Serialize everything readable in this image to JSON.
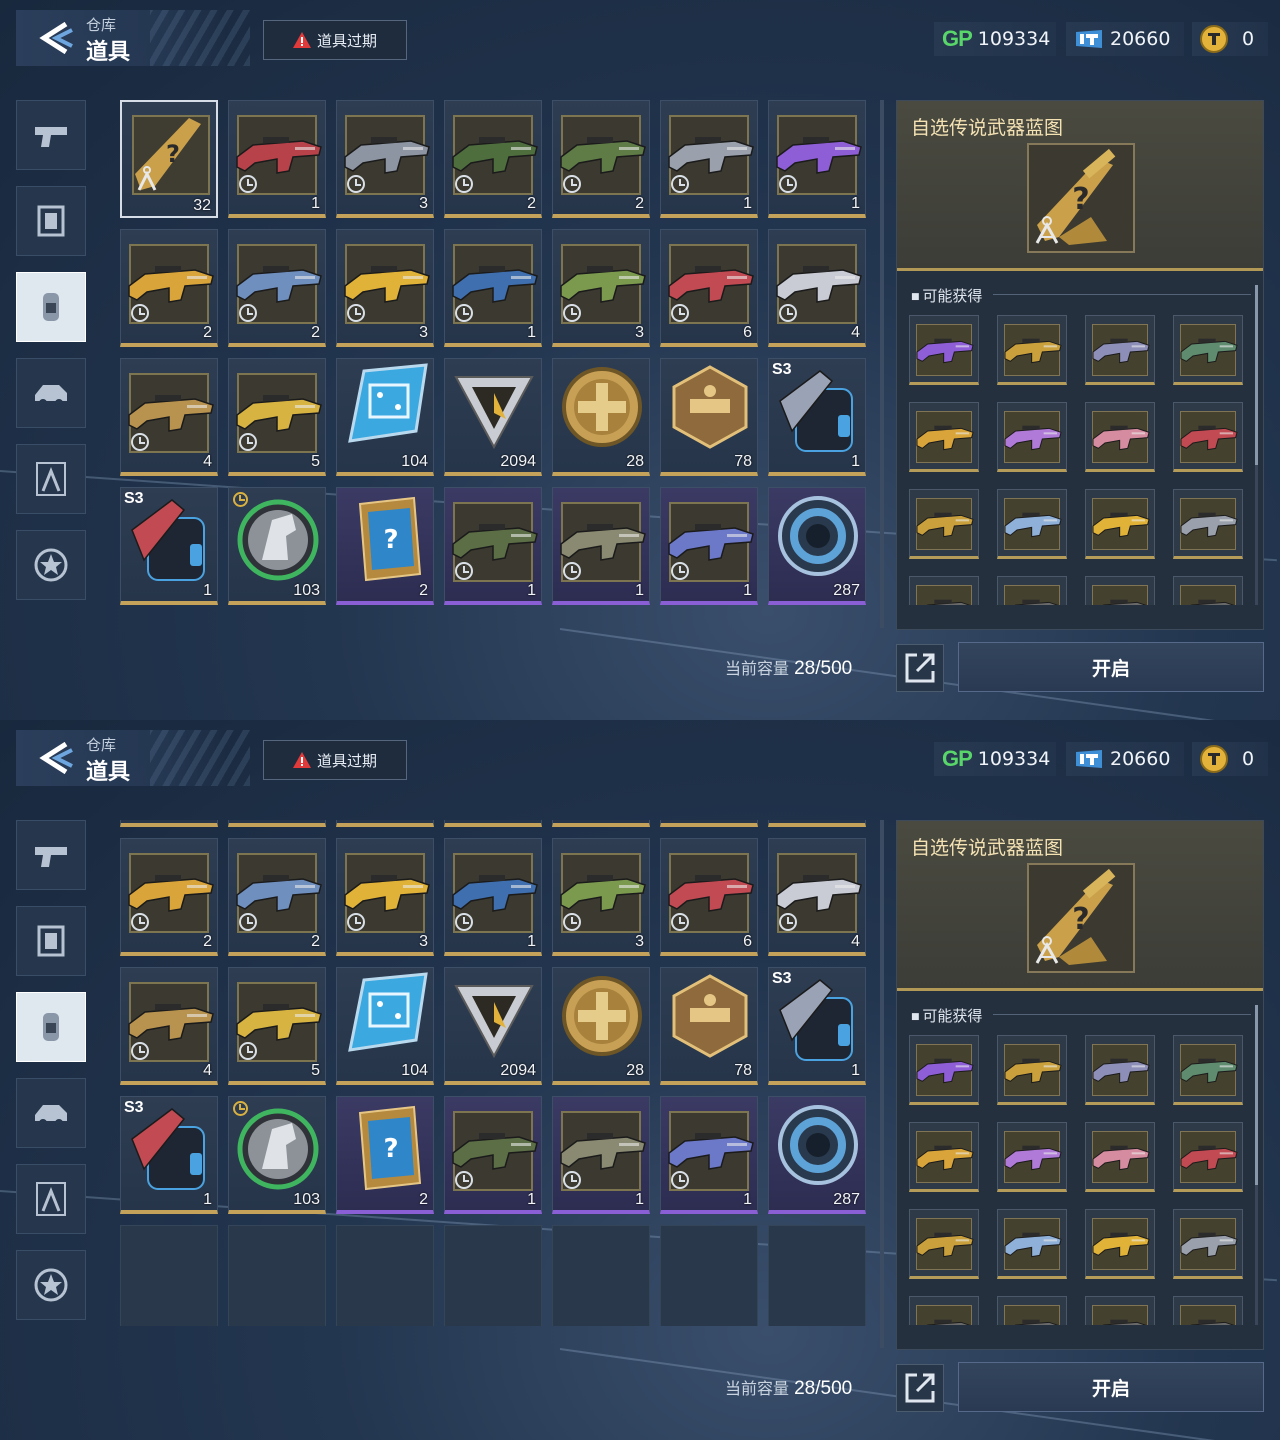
{
  "panels": [
    {
      "header": {
        "breadcrumb": "仓库",
        "title": "道具",
        "expire_button": "道具过期"
      },
      "currencies": {
        "gp_label": "GP",
        "gp": "109334",
        "tickets": "20660",
        "coins": "0"
      },
      "grid_scroll_rows": 0,
      "capacity": {
        "label": "当前容量",
        "value": "28/500"
      },
      "detail": {
        "title": "自选传说武器蓝图",
        "obtain_label": "可能获得"
      },
      "open_button": "开启"
    },
    {
      "header": {
        "breadcrumb": "仓库",
        "title": "道具",
        "expire_button": "道具过期"
      },
      "currencies": {
        "gp_label": "GP",
        "gp": "109334",
        "tickets": "20660",
        "coins": "0"
      },
      "grid_scroll_rows": 1,
      "capacity": {
        "label": "当前容量",
        "value": "28/500"
      },
      "detail": {
        "title": "自选传说武器蓝图",
        "obtain_label": "可能获得"
      },
      "open_button": "开启"
    }
  ],
  "nav_tabs": [
    {
      "icon": "pistol-icon",
      "active": false
    },
    {
      "icon": "frame-icon",
      "active": false
    },
    {
      "icon": "item-canister-icon",
      "active": true
    },
    {
      "icon": "vehicle-icon",
      "active": false
    },
    {
      "icon": "blueprint-compass-icon",
      "active": false
    },
    {
      "icon": "star-badge-icon",
      "active": false
    }
  ],
  "items": [
    {
      "kind": "blueprint",
      "count": "32",
      "selected": true
    },
    {
      "kind": "weapon",
      "color": "#b8424a",
      "count": "1",
      "timed": true
    },
    {
      "kind": "weapon",
      "color": "#8d95a2",
      "count": "3",
      "timed": true
    },
    {
      "kind": "weapon",
      "color": "#4f6e3e",
      "count": "2",
      "timed": true
    },
    {
      "kind": "weapon",
      "color": "#5f7b46",
      "count": "2",
      "timed": true
    },
    {
      "kind": "weapon",
      "color": "#9aa1ad",
      "count": "1",
      "timed": true
    },
    {
      "kind": "weapon",
      "color": "#8e5ed6",
      "count": "1",
      "timed": true
    },
    {
      "kind": "weapon",
      "color": "#d9a53a",
      "count": "2",
      "timed": true
    },
    {
      "kind": "weapon",
      "color": "#6f8fbf",
      "count": "2",
      "timed": true
    },
    {
      "kind": "weapon",
      "color": "#e0b238",
      "count": "3",
      "timed": true
    },
    {
      "kind": "weapon",
      "color": "#3f6fae",
      "count": "1",
      "timed": true
    },
    {
      "kind": "weapon",
      "color": "#7c9a4e",
      "count": "3",
      "timed": true
    },
    {
      "kind": "weapon",
      "color": "#c24a52",
      "count": "6",
      "timed": true
    },
    {
      "kind": "weapon",
      "color": "#c9ccd4",
      "count": "4",
      "timed": true
    },
    {
      "kind": "weapon",
      "color": "#b8934f",
      "count": "4",
      "timed": true
    },
    {
      "kind": "weapon",
      "color": "#d7b342",
      "count": "5",
      "timed": true
    },
    {
      "kind": "chip",
      "count": "104"
    },
    {
      "kind": "triangle",
      "count": "2094"
    },
    {
      "kind": "gold-coin",
      "count": "28"
    },
    {
      "kind": "hex-badge",
      "count": "78"
    },
    {
      "kind": "backpack",
      "season": "S3",
      "color": "#9aa3b6",
      "count": "1"
    },
    {
      "kind": "backpack",
      "season": "S3",
      "color": "#c24a52",
      "count": "1"
    },
    {
      "kind": "horse-medal",
      "count": "103",
      "timed": true
    },
    {
      "kind": "card",
      "count": "2",
      "purple": true
    },
    {
      "kind": "weapon",
      "color": "#5b6e45",
      "count": "1",
      "timed": true,
      "purple": true
    },
    {
      "kind": "weapon",
      "color": "#8a8a72",
      "count": "1",
      "timed": true,
      "purple": true
    },
    {
      "kind": "weapon",
      "color": "#6c78c8",
      "count": "1",
      "timed": true,
      "purple": true
    },
    {
      "kind": "ring",
      "count": "287",
      "purple": true
    }
  ],
  "empty_slots": 7,
  "rewards": [
    {
      "color": "#8e5ed6"
    },
    {
      "color": "#c9a03b"
    },
    {
      "color": "#8d8fb8"
    },
    {
      "color": "#5f8c6f"
    },
    {
      "color": "#d9a53a"
    },
    {
      "color": "#b07ad8"
    },
    {
      "color": "#d68ca0"
    },
    {
      "color": "#c24a52"
    },
    {
      "color": "#c9a03b"
    },
    {
      "color": "#8fb0d8"
    },
    {
      "color": "#e0b238"
    },
    {
      "color": "#9aa1ad"
    },
    {
      "color": "#6a6a6a"
    },
    {
      "color": "#6a6a6a"
    },
    {
      "color": "#6a6a6a"
    },
    {
      "color": "#6a6a6a"
    }
  ]
}
